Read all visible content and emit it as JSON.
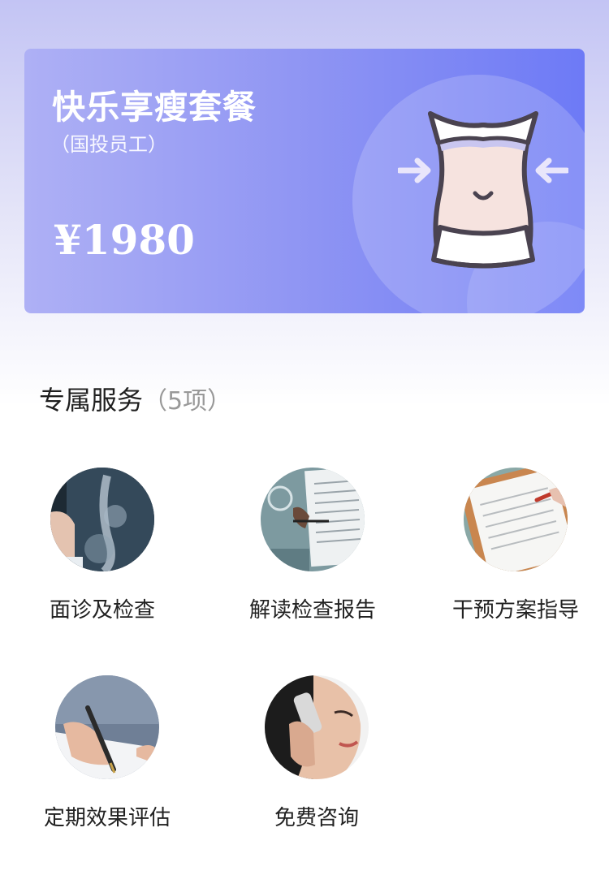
{
  "package": {
    "title": "快乐享瘦套餐",
    "subtitle": "（国投员工）",
    "price": "¥1980",
    "illustration": "waist-slimming-icon"
  },
  "services": {
    "heading": "专属服务",
    "count": "（5项）",
    "items": [
      {
        "label": "面诊及检查",
        "icon": "xray-image"
      },
      {
        "label": "解读检查报告",
        "icon": "report-reading-image"
      },
      {
        "label": "干预方案指导",
        "icon": "daily-report-image"
      },
      {
        "label": "定期效果评估",
        "icon": "writing-pen-image"
      },
      {
        "label": "免费咨询",
        "icon": "phone-call-image"
      }
    ]
  },
  "colors": {
    "accent": "#6d7af6",
    "card_light": "#aeb0f5",
    "text": "#222222",
    "muted": "#999999"
  }
}
